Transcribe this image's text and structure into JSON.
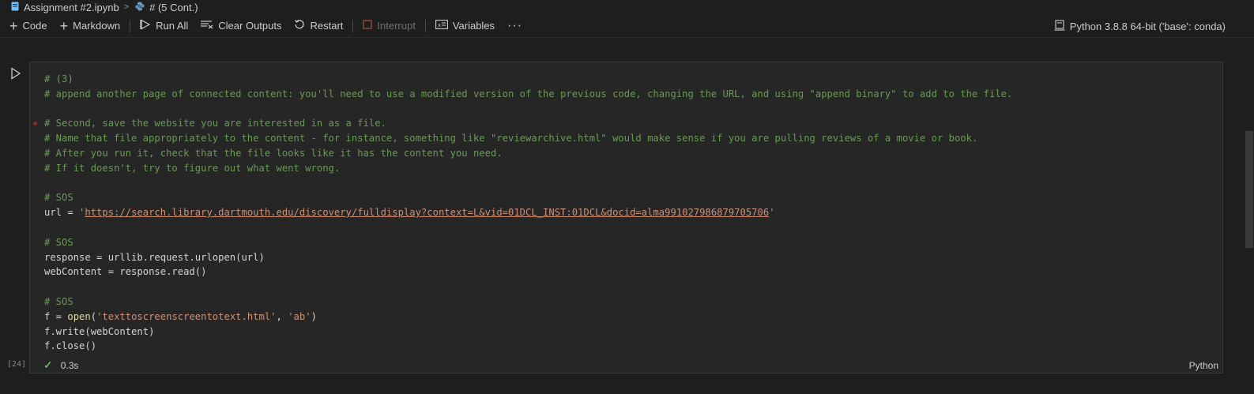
{
  "breadcrumb": {
    "file": "Assignment #2.ipynb",
    "cell": "# (5 Cont.)",
    "file_icon": "notebook-file-icon",
    "cell_icon": "python-icon"
  },
  "toolbar": {
    "code": "Code",
    "markdown": "Markdown",
    "run_all": "Run All",
    "clear_outputs": "Clear Outputs",
    "restart": "Restart",
    "interrupt": "Interrupt",
    "variables": "Variables",
    "more": "···",
    "kernel": "Python 3.8.8 64-bit ('base': conda)"
  },
  "cell": {
    "execution_count": "[24]",
    "duration": "0.3s",
    "language": "Python",
    "lines": [
      "# (3)",
      "# append another page of connected content: you'll need to use a modified version of the previous code, changing the URL, and using \"append binary\" to add to the file.",
      "",
      "# Second, save the website you are interested in as a file.",
      "# Name that file appropriately to the content - for instance, something like \"reviewarchive.html\" would make sense if you are pulling reviews of a movie or book.",
      "# After you run it, check that the file looks like it has the content you need.",
      "# If it doesn't, try to figure out what went wrong.",
      "",
      "# SOS",
      "url = 'https://search.library.dartmouth.edu/discovery/fulldisplay?context=L&vid=01DCL_INST:01DCL&docid=alma991027986879705706'",
      "",
      "# SOS",
      "response = urllib.request.urlopen(url)",
      "webContent = response.read()",
      "",
      "# SOS",
      "f = open('texttoscreenscreentotext.html', 'ab')",
      "f.write(webContent)",
      "f.close()"
    ]
  },
  "colors": {
    "comment": "#6a9955",
    "string": "#ce9178",
    "function": "#dcdcaa",
    "success": "#89d185"
  }
}
